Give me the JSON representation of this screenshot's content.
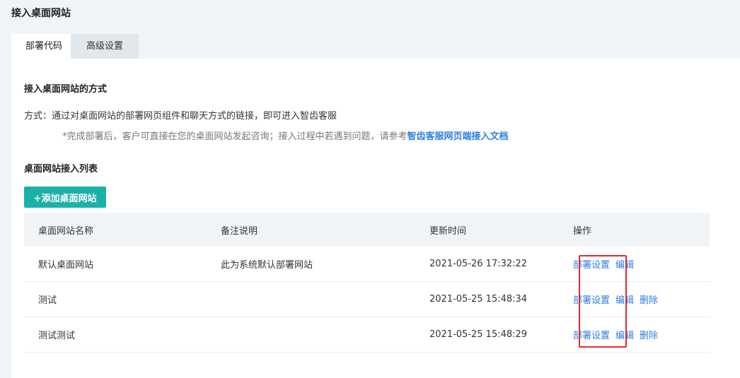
{
  "page_title": "接入桌面网站",
  "tabs": [
    {
      "label": "部署代码",
      "active": true
    },
    {
      "label": "高级设置",
      "active": false
    }
  ],
  "section_method_title": "接入桌面网站的方式",
  "method_text": "方式：通过对桌面网站的部署网页组件和聊天方式的链接，即可进入智齿客服",
  "note_text": "*完成部署后，客户可直接在您的桌面网站发起咨询；接入过程中若遇到问题，请参考",
  "note_link": "智齿客服网页端接入文档",
  "section_list_title": "桌面网站接入列表",
  "add_button": "+添加桌面网站",
  "table": {
    "headers": [
      "桌面网站名称",
      "备注说明",
      "更新时间",
      "操作"
    ],
    "rows": [
      {
        "name": "默认桌面网站",
        "note": "此为系统默认部署网站",
        "time": "2021-05-26 17:32:22",
        "ops": [
          "部署设置",
          "编辑"
        ]
      },
      {
        "name": "测试",
        "note": "",
        "time": "2021-05-25 15:48:34",
        "ops": [
          "部署设置",
          "编辑",
          "删除"
        ]
      },
      {
        "name": "测试测试",
        "note": "",
        "time": "2021-05-25 15:48:29",
        "ops": [
          "部署设置",
          "编辑",
          "删除"
        ]
      }
    ]
  },
  "colors": {
    "accent": "#1cb1a8",
    "link": "#2f7de1",
    "highlight": "#e8262c"
  }
}
